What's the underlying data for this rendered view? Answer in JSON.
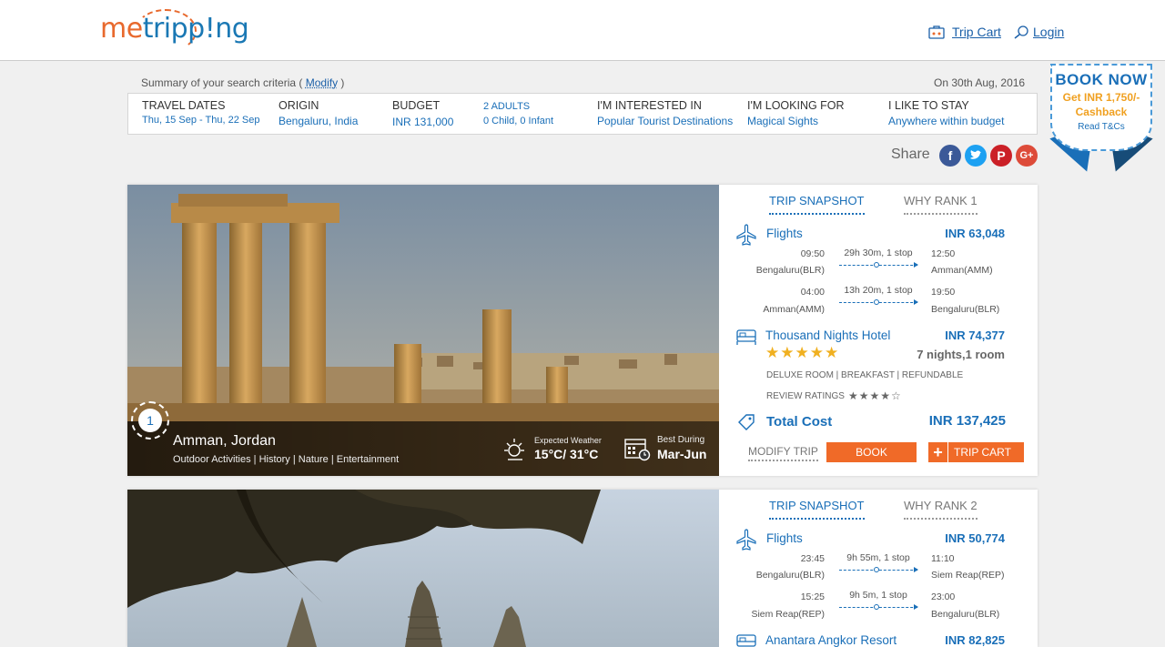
{
  "header": {
    "logo_left": "me",
    "logo_right": "tripp!ng",
    "trip_cart": "Trip Cart",
    "login": "Login"
  },
  "summary": {
    "title_prefix": "Summary of your search criteria (",
    "modify": "Modify",
    "title_suffix": ")",
    "date": "On 30th Aug, 2016",
    "travel_dates_label": "Travel Dates",
    "travel_dates": "Thu, 15 Sep - Thu, 22 Sep",
    "origin_label": "Origin",
    "origin": "Bengaluru, India",
    "budget_label": "Budget",
    "budget": "INR 131,000",
    "adults": "2 ADULTS",
    "children": "0 Child, 0 Infant",
    "interest_label": "I'm interested in",
    "interest": "Popular Tourist Destinations",
    "looking_label": "I'm looking for",
    "looking": "Magical Sights",
    "stay_label": "I like to stay",
    "stay": "Anywhere within budget"
  },
  "badge": {
    "title": "BOOK NOW",
    "offer_line1": "Get INR 1,750/-",
    "offer_line2": "Cashback",
    "tc": "Read T&Cs"
  },
  "share": {
    "label": "Share",
    "icons": [
      "facebook-icon",
      "twitter-icon",
      "pinterest-icon",
      "google-plus-icon"
    ]
  },
  "trips": [
    {
      "rank": "1",
      "destination": "Amman, Jordan",
      "tags": "Outdoor Activities | History | Nature | Entertainment",
      "weather_label": "Expected Weather",
      "weather": "15°C/ 31°C",
      "best_label": "Best During",
      "best": "Mar-Jun",
      "tab_snapshot": "Trip Snapshot",
      "tab_why": "Why Rank 1",
      "flights_label": "Flights",
      "flights_price": "INR 63,048",
      "legs": [
        {
          "dep_time": "09:50",
          "dep_city": "Bengaluru(BLR)",
          "duration": "29h 30m, 1 stop",
          "arr_time": "12:50",
          "arr_city": "Amman(AMM)"
        },
        {
          "dep_time": "04:00",
          "dep_city": "Amman(AMM)",
          "duration": "13h 20m, 1 stop",
          "arr_time": "19:50",
          "arr_city": "Bengaluru(BLR)"
        }
      ],
      "hotel_name": "Thousand Nights Hotel",
      "hotel_price": "INR 74,377",
      "hotel_stars": "★★★★★",
      "hotel_star_count": 5,
      "nights": "7 nights,1 room",
      "features": "Deluxe Room | Breakfast | Refundable",
      "review_label": "REVIEW RATINGS",
      "review_stars": "★★★★☆",
      "review_rating": 4,
      "total_label": "Total Cost",
      "total": "INR 137,425",
      "modify_btn": "Modify Trip",
      "book_btn": "Book",
      "cart_btn": "Trip Cart"
    },
    {
      "tab_snapshot": "Trip Snapshot",
      "tab_why": "Why Rank 2",
      "flights_label": "Flights",
      "flights_price": "INR 50,774",
      "legs": [
        {
          "dep_time": "23:45",
          "dep_city": "Bengaluru(BLR)",
          "duration": "9h 55m, 1 stop",
          "arr_time": "11:10",
          "arr_city": "Siem Reap(REP)"
        },
        {
          "dep_time": "15:25",
          "dep_city": "Siem Reap(REP)",
          "duration": "9h 5m, 1 stop",
          "arr_time": "23:00",
          "arr_city": "Bengaluru(BLR)"
        }
      ],
      "hotel_name": "Anantara Angkor Resort",
      "hotel_price": "INR 82,825"
    }
  ]
}
